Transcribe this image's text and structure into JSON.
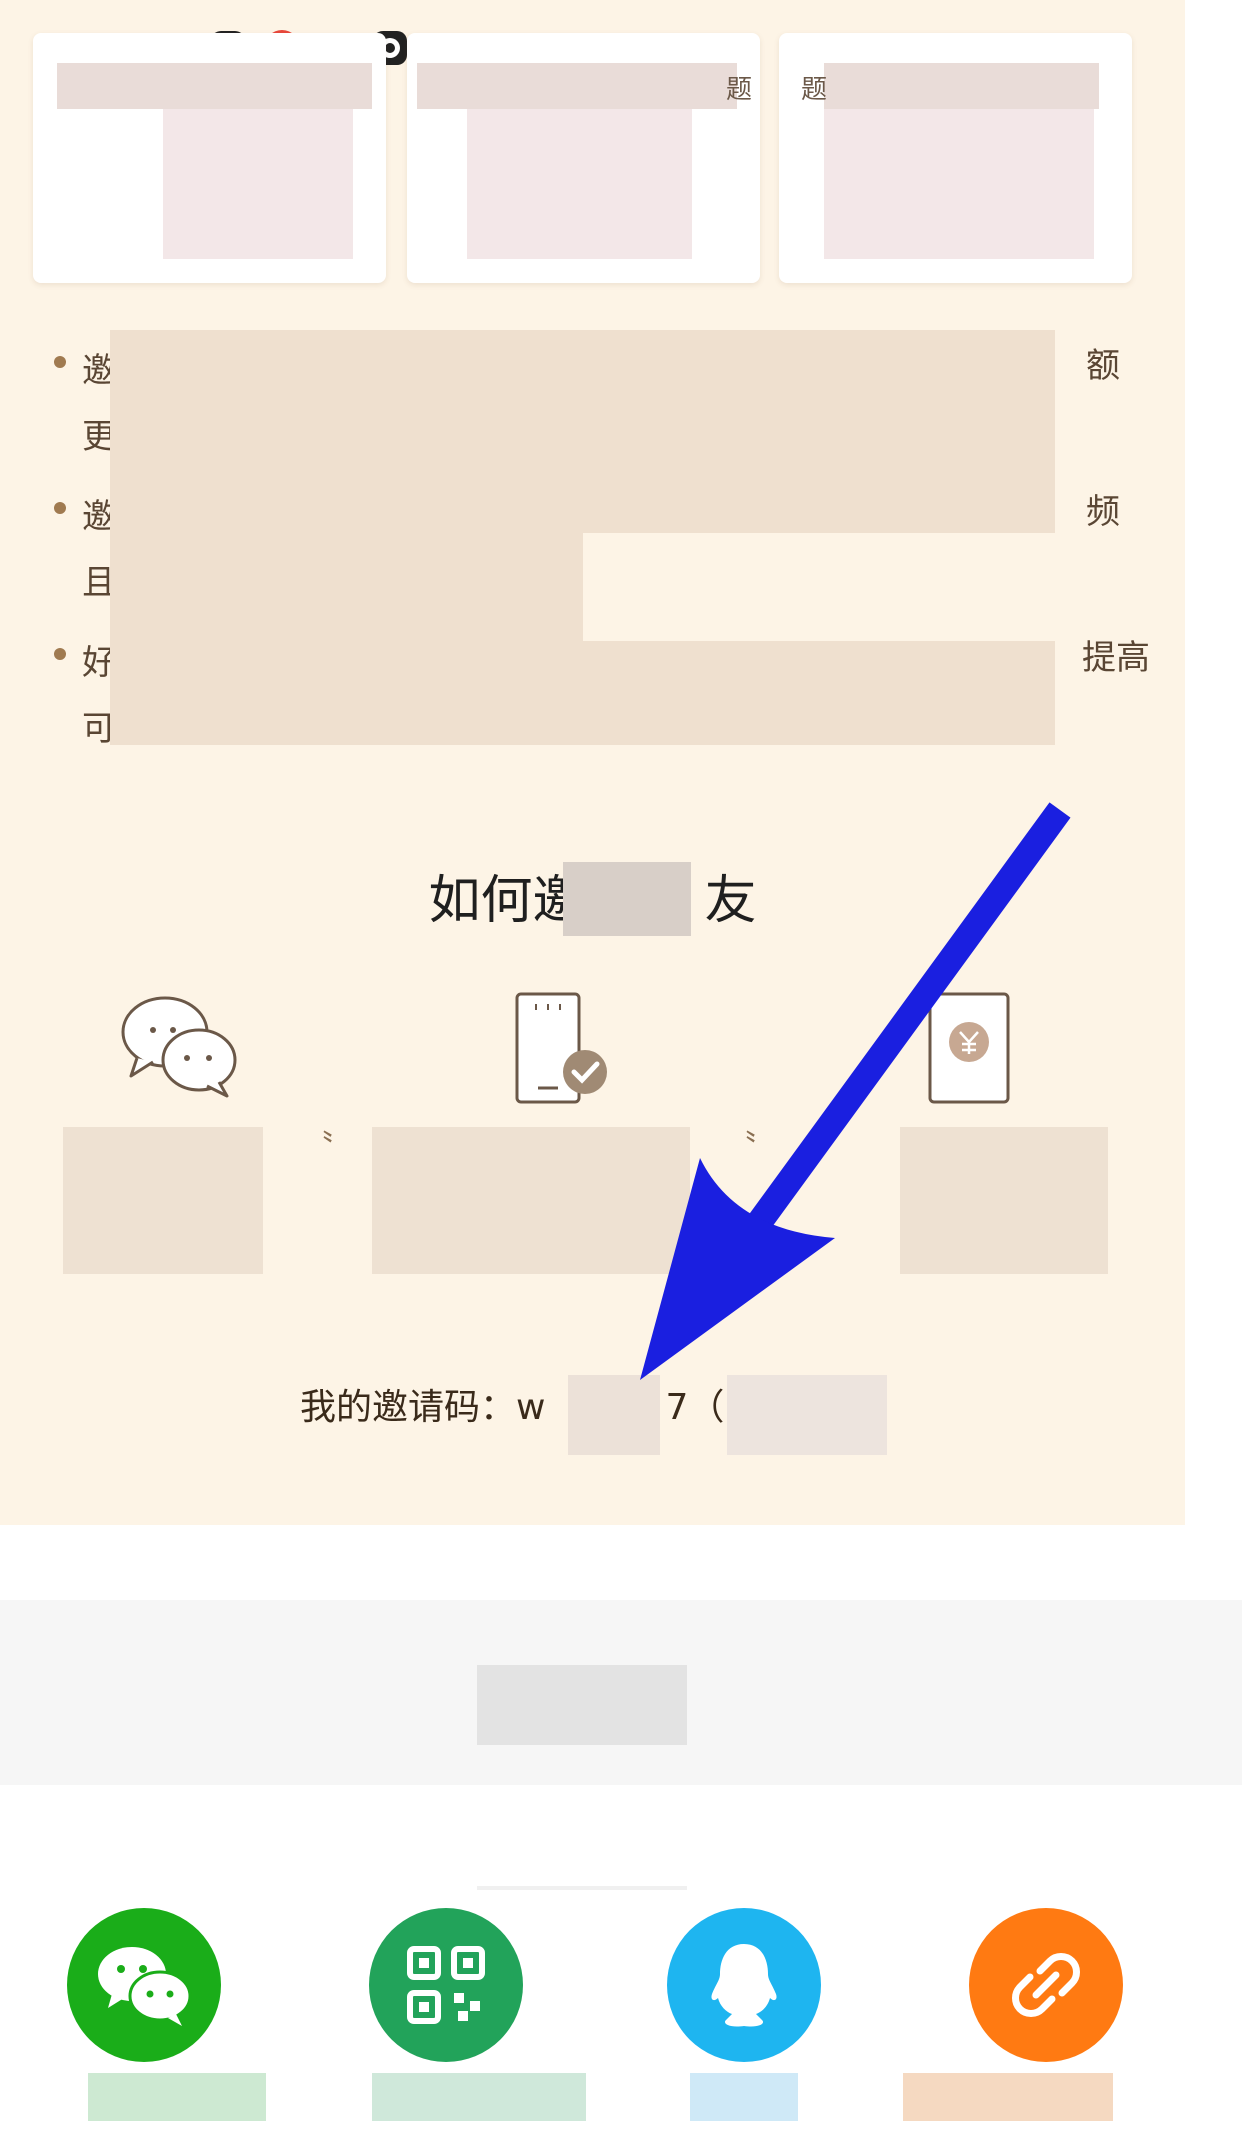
{
  "how_to_invite": {
    "title_left": "如何",
    "title_partial": "邀",
    "title_right": "友"
  },
  "rules": [
    {
      "lead": "邀",
      "lead2": "更",
      "tail": "额"
    },
    {
      "lead": "邀",
      "lead2": "且",
      "tail": "频"
    },
    {
      "lead": "好",
      "lead2": "可",
      "tail": "提高"
    }
  ],
  "cards": [
    {
      "side_char": ""
    },
    {
      "side_char": "题"
    },
    {
      "side_char": "题"
    }
  ],
  "invite_code": {
    "label": "我的邀请码：",
    "visible_prefix": "w",
    "visible_suffix": "7（"
  },
  "share_options": [
    {
      "icon": "wechat-icon",
      "color": "#1aad19"
    },
    {
      "icon": "qrcode-icon",
      "color": "#22a35a"
    },
    {
      "icon": "qq-icon",
      "color": "#1eb5f0"
    },
    {
      "icon": "link-icon",
      "color": "#ff7a12"
    }
  ],
  "colors": {
    "panel_background": "#fdf4e6",
    "annotation_arrow": "#1a1fe0"
  }
}
